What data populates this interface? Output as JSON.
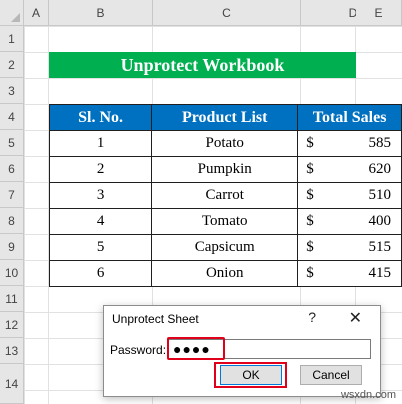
{
  "columns": [
    "A",
    "B",
    "C",
    "D",
    "E"
  ],
  "rows": [
    "1",
    "2",
    "3",
    "4",
    "5",
    "6",
    "7",
    "8",
    "9",
    "10",
    "11",
    "12",
    "13",
    "14"
  ],
  "banner": "Unprotect Workbook",
  "table": {
    "headers": [
      "Sl. No.",
      "Product List",
      "Total Sales"
    ],
    "rows": [
      {
        "sl": "1",
        "product": "Potato",
        "currency": "$",
        "sales": "585"
      },
      {
        "sl": "2",
        "product": "Pumpkin",
        "currency": "$",
        "sales": "620"
      },
      {
        "sl": "3",
        "product": "Carrot",
        "currency": "$",
        "sales": "510"
      },
      {
        "sl": "4",
        "product": "Tomato",
        "currency": "$",
        "sales": "400"
      },
      {
        "sl": "5",
        "product": "Capsicum",
        "currency": "$",
        "sales": "515"
      },
      {
        "sl": "6",
        "product": "Onion",
        "currency": "$",
        "sales": "415"
      }
    ]
  },
  "dialog": {
    "title": "Unprotect Sheet",
    "help": "?",
    "close": "✕",
    "password_label": "Password:",
    "password_value": "●●●●",
    "ok": "OK",
    "cancel": "Cancel"
  },
  "watermark": "wsxdn.com",
  "colors": {
    "banner": "#00b050",
    "header": "#0070c0",
    "highlight": "#e0001b"
  }
}
